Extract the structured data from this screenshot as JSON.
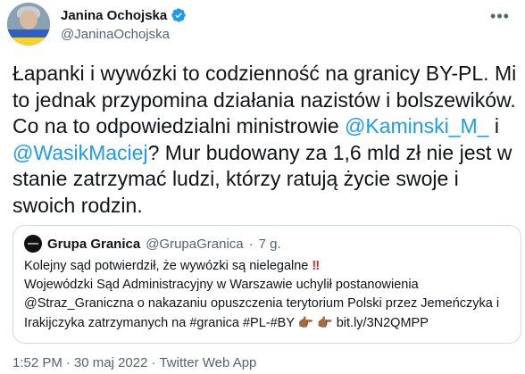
{
  "author": {
    "name": "Janina Ochojska",
    "handle": "@JaninaOchojska",
    "verified": true,
    "avatar_flag_colors": [
      "#2f5fc4",
      "#f2d335"
    ]
  },
  "more_icon": "more-horizontal-icon",
  "tweet": {
    "text_1": "Łapanki i wywózki to codzienność na granicy BY-PL. Mi to jednak przypomina działania nazistów i bolszewików. Co na to odpowiedzialni ministrowie ",
    "mention_1": "@Kaminski_M_",
    "text_2": " i ",
    "mention_2": "@WasikMaciej",
    "text_3": "? Mur budowany za 1,6 mld zł nie jest w stanie zatrzymać ludzi, którzy ratują życie swoje i swoich rodzin."
  },
  "quote": {
    "name": "Grupa Granica",
    "handle": "@GrupaGranica",
    "time": "7 g.",
    "line_1": "Kolejny sąd potwierdził, że wywózki są nielegalne ",
    "bang": "‼",
    "line_2": "Wojewódzki Sąd Administracyjny w Warszawie uchylił postanowienia",
    "line_3": "@Straz_Graniczna o nakazaniu opuszczenia terytorium Polski przez Jemeńczyka i",
    "line_4": "Irakijczyka zatrzymanych na #granica #PL-#BY ",
    "hand_1": "👉🏾",
    "hand_2": "👉🏾",
    "link": "bit.ly/3N2QMPP"
  },
  "footer": {
    "time": "1:52 PM",
    "date": "30 maj 2022",
    "source": "Twitter Web App"
  },
  "colors": {
    "link": "#1d9bf0",
    "secondary_text": "#536471",
    "border": "#cfd9de"
  }
}
